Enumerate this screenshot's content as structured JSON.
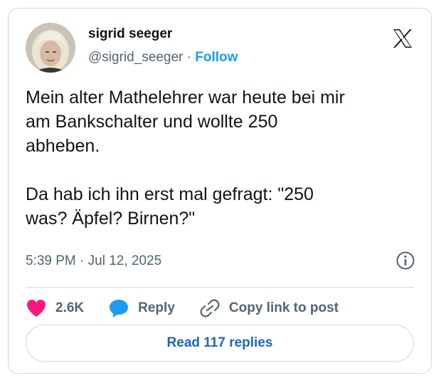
{
  "author": {
    "name": "sigrid seeger",
    "handle": "@sigrid_seeger",
    "separator": " · ",
    "follow_label": "Follow"
  },
  "post": {
    "text": "Mein alter Mathelehrer war heute bei mir\nam Bankschalter und wollte 250\nabheben.\n\nDa hab ich ihn erst mal gefragt: \"250\nwas? Äpfel? Birnen?\"",
    "timestamp": "5:39 PM · Jul 12, 2025"
  },
  "actions": {
    "like_count": "2.6K",
    "reply_label": "Reply",
    "copy_link_label": "Copy link to post",
    "read_replies_label": "Read 117 replies"
  },
  "colors": {
    "accent": "#1d9bf0",
    "like": "#f91880",
    "muted": "#536471"
  }
}
